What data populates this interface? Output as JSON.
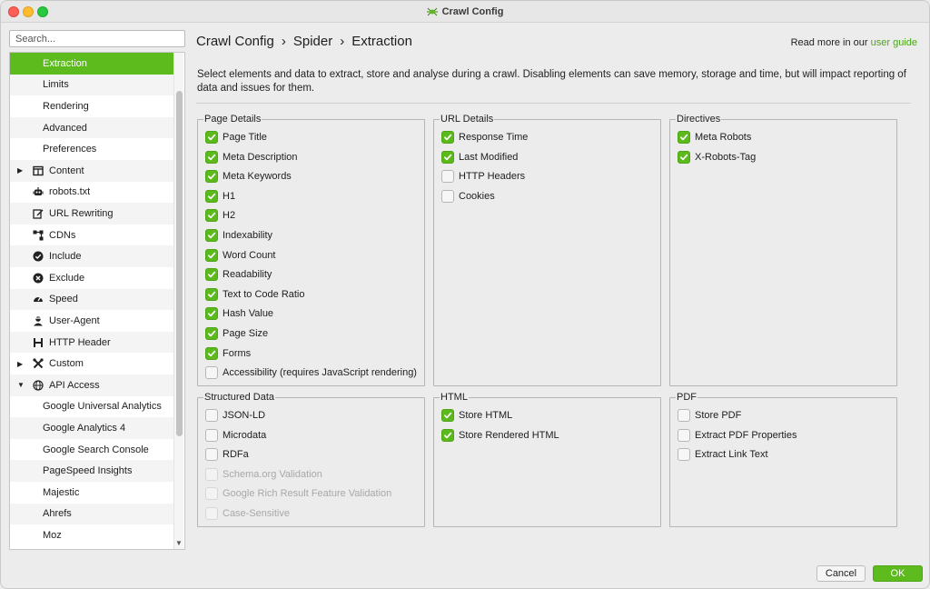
{
  "window": {
    "title": "Crawl Config"
  },
  "sidebar": {
    "search_placeholder": "Search...",
    "items": [
      {
        "label": "Extraction",
        "level": 1,
        "selected": true
      },
      {
        "label": "Limits",
        "level": 1
      },
      {
        "label": "Rendering",
        "level": 1
      },
      {
        "label": "Advanced",
        "level": 1
      },
      {
        "label": "Preferences",
        "level": 1
      },
      {
        "label": "Content",
        "level": 0,
        "icon": "columns-icon",
        "arrow": "collapsed"
      },
      {
        "label": "robots.txt",
        "level": 0,
        "icon": "robot-icon"
      },
      {
        "label": "URL Rewriting",
        "level": 0,
        "icon": "edit-icon"
      },
      {
        "label": "CDNs",
        "level": 0,
        "icon": "network-icon"
      },
      {
        "label": "Include",
        "level": 0,
        "icon": "check-circle-icon"
      },
      {
        "label": "Exclude",
        "level": 0,
        "icon": "x-circle-icon"
      },
      {
        "label": "Speed",
        "level": 0,
        "icon": "gauge-icon"
      },
      {
        "label": "User-Agent",
        "level": 0,
        "icon": "user-agent-icon"
      },
      {
        "label": "HTTP Header",
        "level": 0,
        "icon": "header-icon"
      },
      {
        "label": "Custom",
        "level": 0,
        "icon": "tools-icon",
        "arrow": "collapsed"
      },
      {
        "label": "API Access",
        "level": 0,
        "icon": "globe-icon",
        "arrow": "expanded"
      },
      {
        "label": "Google Universal Analytics",
        "level": 1
      },
      {
        "label": "Google Analytics 4",
        "level": 1
      },
      {
        "label": "Google Search Console",
        "level": 1
      },
      {
        "label": "PageSpeed Insights",
        "level": 1
      },
      {
        "label": "Majestic",
        "level": 1
      },
      {
        "label": "Ahrefs",
        "level": 1
      },
      {
        "label": "Moz",
        "level": 1
      }
    ]
  },
  "header": {
    "breadcrumb": [
      "Crawl Config",
      "Spider",
      "Extraction"
    ],
    "separator": "›",
    "readmore_text": "Read more in our",
    "readmore_link": "user guide"
  },
  "description": "Select elements and data to extract, store and analyse during a crawl. Disabling elements can save memory, storage and time, but will impact reporting of data and issues for them.",
  "groups": {
    "page_details": {
      "title": "Page Details",
      "items": [
        {
          "label": "Page Title",
          "checked": true
        },
        {
          "label": "Meta Description",
          "checked": true
        },
        {
          "label": "Meta Keywords",
          "checked": true
        },
        {
          "label": "H1",
          "checked": true
        },
        {
          "label": "H2",
          "checked": true
        },
        {
          "label": "Indexability",
          "checked": true
        },
        {
          "label": "Word Count",
          "checked": true
        },
        {
          "label": "Readability",
          "checked": true
        },
        {
          "label": "Text to Code Ratio",
          "checked": true
        },
        {
          "label": "Hash Value",
          "checked": true
        },
        {
          "label": "Page Size",
          "checked": true
        },
        {
          "label": "Forms",
          "checked": true
        },
        {
          "label": "Accessibility (requires JavaScript rendering)",
          "checked": false
        }
      ]
    },
    "url_details": {
      "title": "URL Details",
      "items": [
        {
          "label": "Response Time",
          "checked": true
        },
        {
          "label": "Last Modified",
          "checked": true
        },
        {
          "label": "HTTP Headers",
          "checked": false
        },
        {
          "label": "Cookies",
          "checked": false
        }
      ]
    },
    "directives": {
      "title": "Directives",
      "items": [
        {
          "label": "Meta Robots",
          "checked": true
        },
        {
          "label": "X-Robots-Tag",
          "checked": true
        }
      ]
    },
    "structured_data": {
      "title": "Structured Data",
      "items": [
        {
          "label": "JSON-LD",
          "checked": false
        },
        {
          "label": "Microdata",
          "checked": false
        },
        {
          "label": "RDFa",
          "checked": false
        },
        {
          "label": "Schema.org Validation",
          "checked": false,
          "disabled": true
        },
        {
          "label": "Google Rich Result Feature Validation",
          "checked": false,
          "disabled": true
        },
        {
          "label": "Case-Sensitive",
          "checked": false,
          "disabled": true
        }
      ]
    },
    "html": {
      "title": "HTML",
      "items": [
        {
          "label": "Store HTML",
          "checked": true
        },
        {
          "label": "Store Rendered HTML",
          "checked": true
        }
      ]
    },
    "pdf": {
      "title": "PDF",
      "items": [
        {
          "label": "Store PDF",
          "checked": false
        },
        {
          "label": "Extract PDF Properties",
          "checked": false
        },
        {
          "label": "Extract Link Text",
          "checked": false
        }
      ]
    }
  },
  "footer": {
    "cancel_label": "Cancel",
    "ok_label": "OK"
  },
  "colors": {
    "accent": "#5dbb1e",
    "link": "#4aa613"
  }
}
